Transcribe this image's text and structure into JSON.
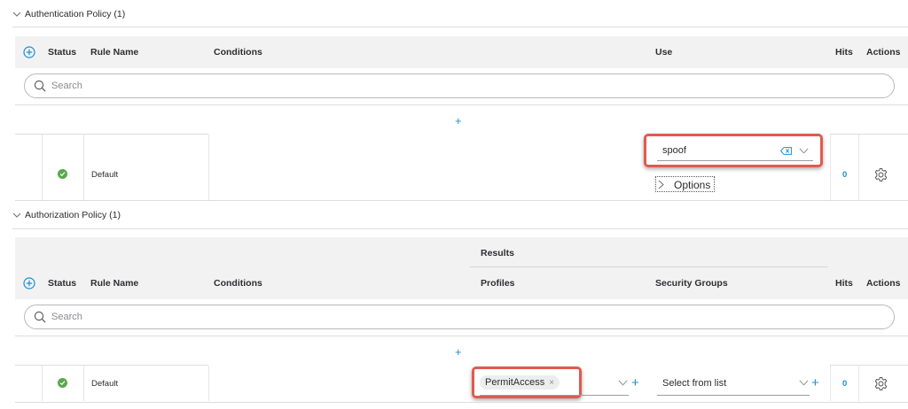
{
  "auth": {
    "title": "Authentication Policy (1)",
    "headers": {
      "status": "Status",
      "rule_name": "Rule Name",
      "conditions": "Conditions",
      "use": "Use",
      "hits": "Hits",
      "actions": "Actions"
    },
    "search_placeholder": "Search",
    "row": {
      "rule_name": "Default",
      "use_value": "spoof",
      "options_label": "Options",
      "hits": "0"
    }
  },
  "authz": {
    "title": "Authorization Policy (1)",
    "headers": {
      "results": "Results",
      "status": "Status",
      "rule_name": "Rule Name",
      "conditions": "Conditions",
      "profiles": "Profiles",
      "security_groups": "Security Groups",
      "hits": "Hits",
      "actions": "Actions"
    },
    "search_placeholder": "Search",
    "row": {
      "rule_name": "Default",
      "profile_tag": "PermitAccess",
      "security_group_placeholder": "Select from list",
      "hits": "0"
    }
  },
  "colors": {
    "accent": "#1d8fd1",
    "status_ok": "#58a94b",
    "highlight": "#e05a4f",
    "header_bg": "#f2f2f3"
  },
  "icons": {
    "add": "plus-circle-icon",
    "search": "search-icon",
    "status": "check-circle-icon",
    "actions": "gear-icon",
    "clear": "backspace-icon",
    "dropdown": "chevron-down-icon"
  }
}
